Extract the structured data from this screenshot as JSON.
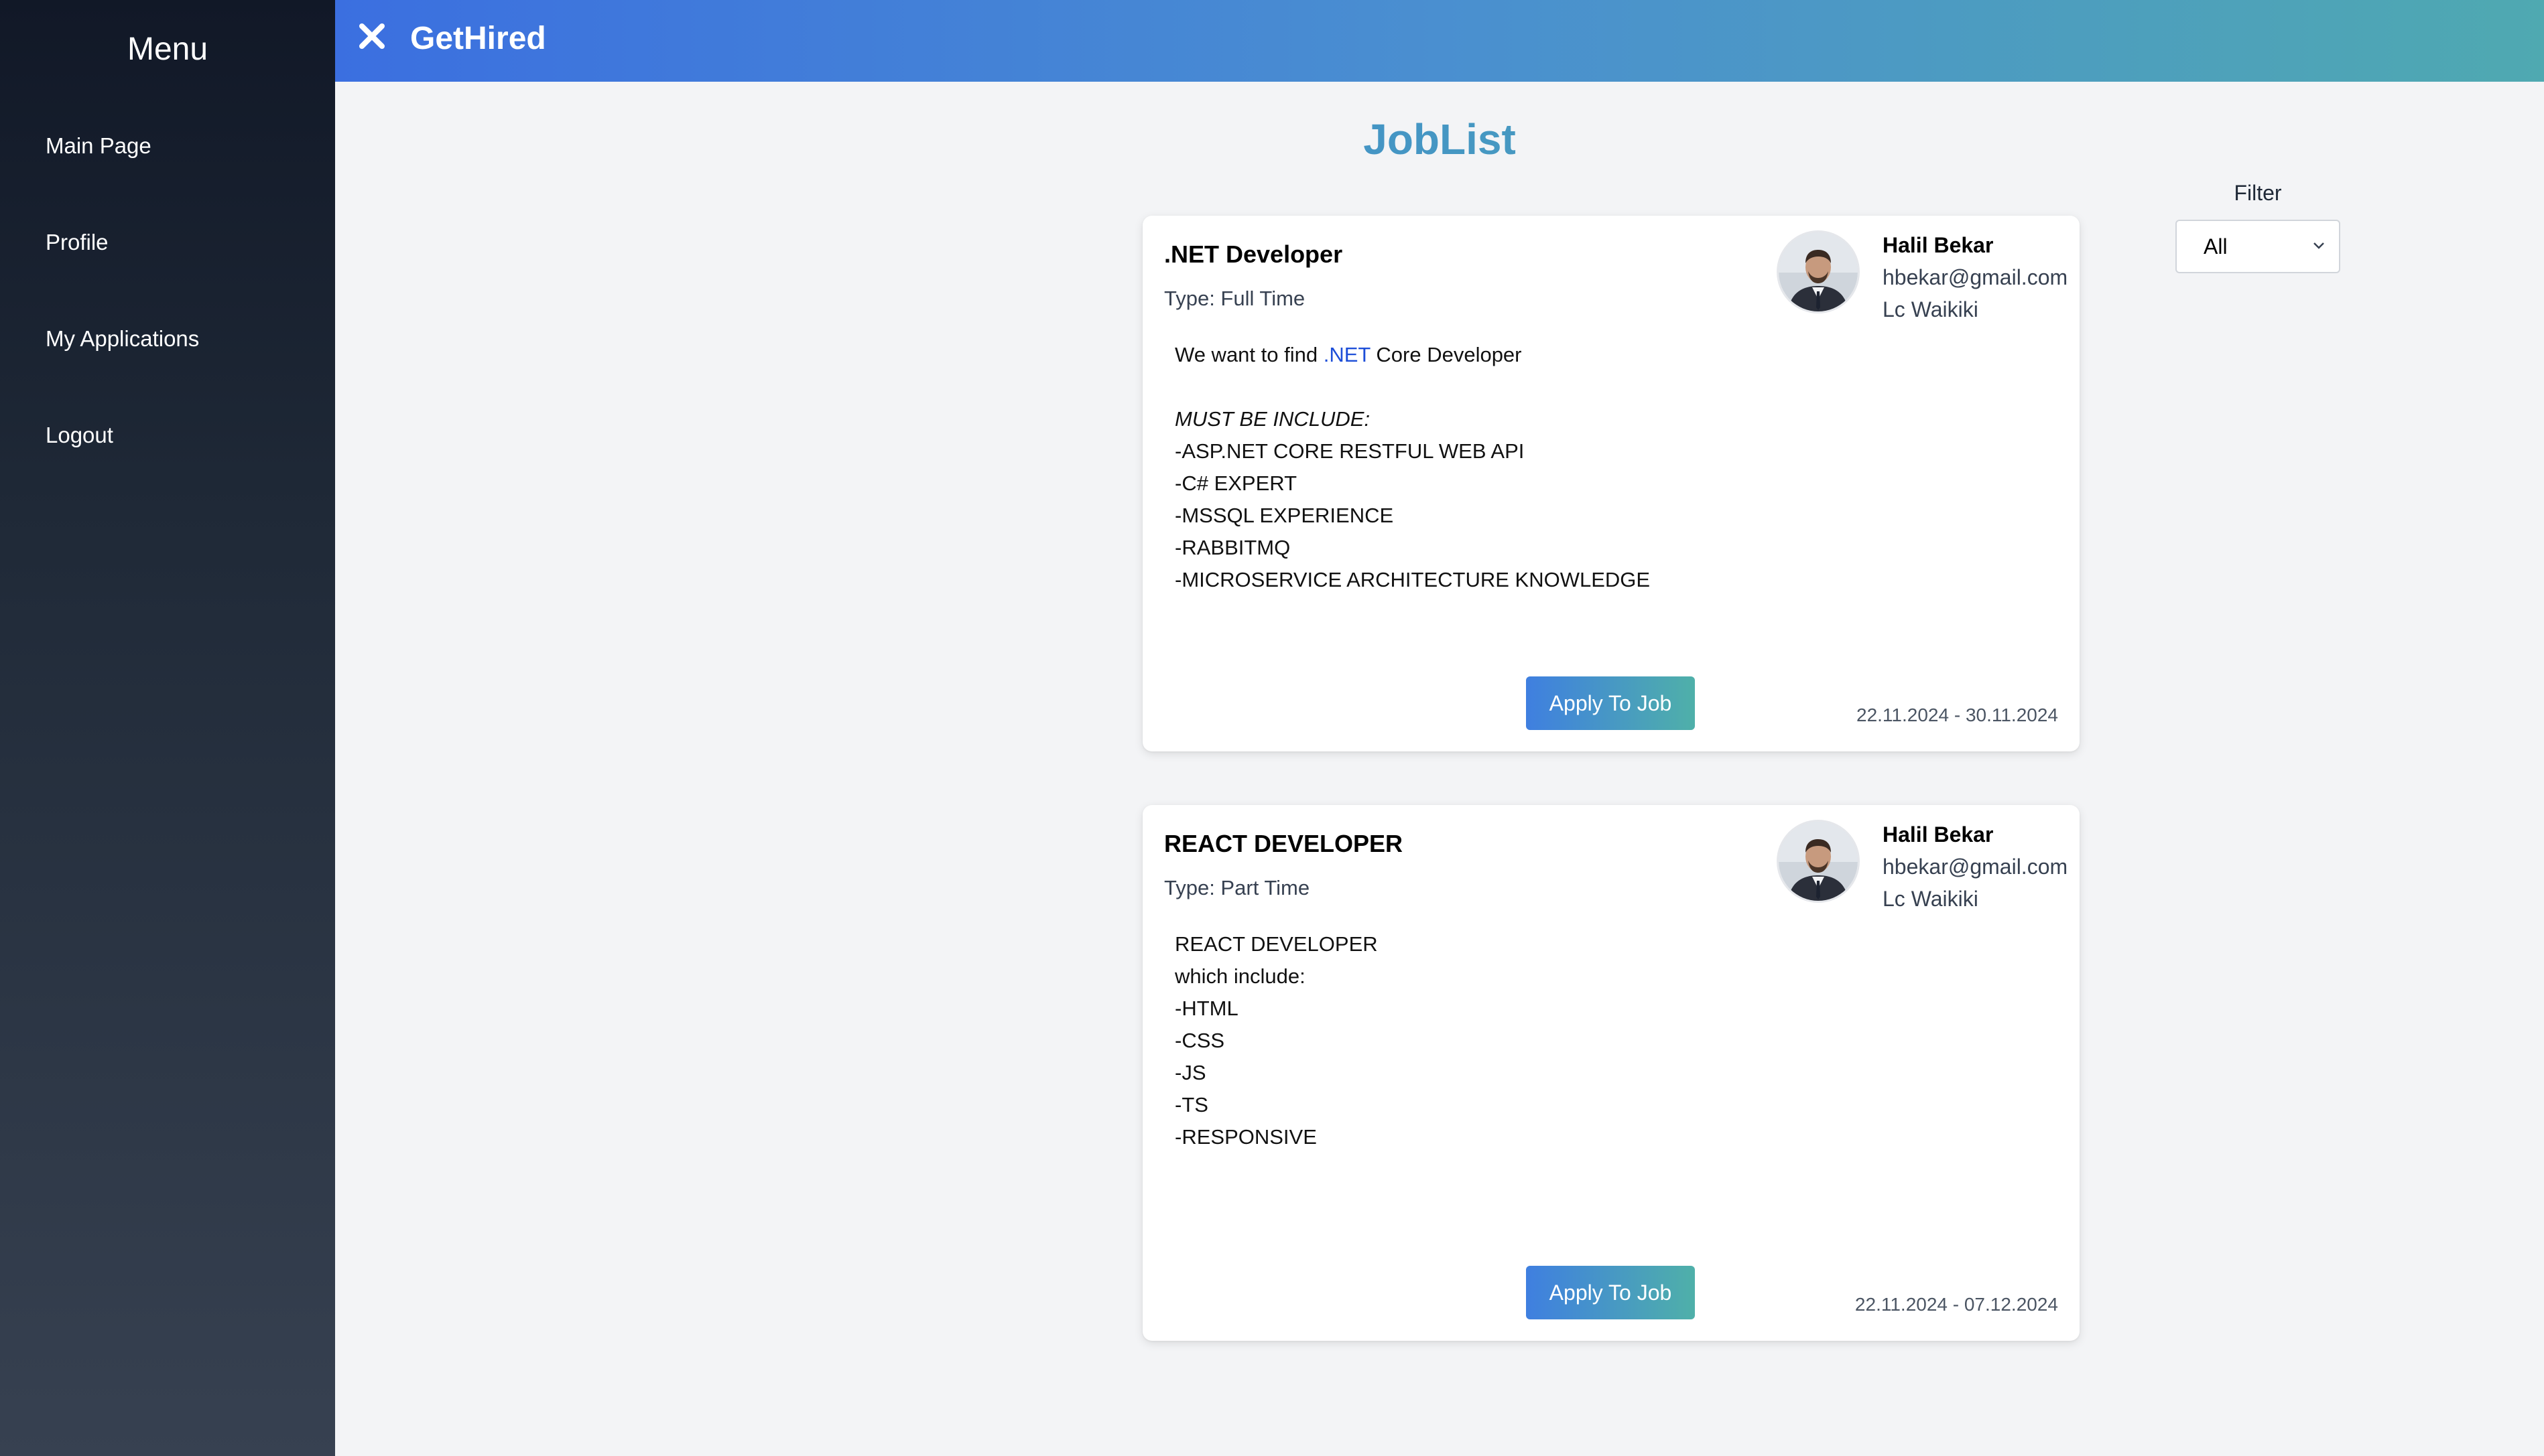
{
  "sidebar": {
    "title": "Menu",
    "items": [
      {
        "label": "Main Page"
      },
      {
        "label": "Profile"
      },
      {
        "label": "My Applications"
      },
      {
        "label": "Logout"
      }
    ]
  },
  "header": {
    "brand": "GetHired",
    "close_icon": "close-icon"
  },
  "main": {
    "title_part1": "Job ",
    "title_part2": "List",
    "filter": {
      "label": "Filter",
      "selected": "All"
    },
    "jobs": [
      {
        "title": ".NET Developer",
        "type": "Type: Full Time",
        "desc_intro_before": "We want to find ",
        "desc_intro_link": ".NET",
        "desc_intro_after": " Core Developer",
        "desc_heading": "MUST BE INCLUDE:",
        "desc_lines": [
          "-ASP.NET CORE RESTFUL WEB API",
          "-C# EXPERT",
          "-MSSQL EXPERIENCE",
          "-RABBITMQ",
          "-MICROSERVICE ARCHITECTURE KNOWLEDGE"
        ],
        "owner_name": "Halil Bekar",
        "owner_email": "hbekar@gmail.com",
        "owner_company": "Lc Waikiki",
        "apply_label": "Apply To Job",
        "dates": "22.11.2024 - 30.11.2024"
      },
      {
        "title": "REACT DEVELOPER",
        "type": "Type: Part Time",
        "desc_lines": [
          "REACT DEVELOPER",
          "which include:",
          "-HTML",
          "-CSS",
          "-JS",
          "-TS",
          "-RESPONSIVE"
        ],
        "owner_name": "Halil Bekar",
        "owner_email": "hbekar@gmail.com",
        "owner_company": "Lc Waikiki",
        "apply_label": "Apply To Job",
        "dates": "22.11.2024 - 07.12.2024"
      }
    ]
  },
  "colors": {
    "sidebar_top": "#111827",
    "sidebar_bottom": "#374151",
    "header_start": "#3b6fe0",
    "header_end": "#4fa9b1",
    "accent_blue": "#3f7fe0",
    "accent_teal": "#4fb0a9",
    "link": "#1d4ed8"
  }
}
